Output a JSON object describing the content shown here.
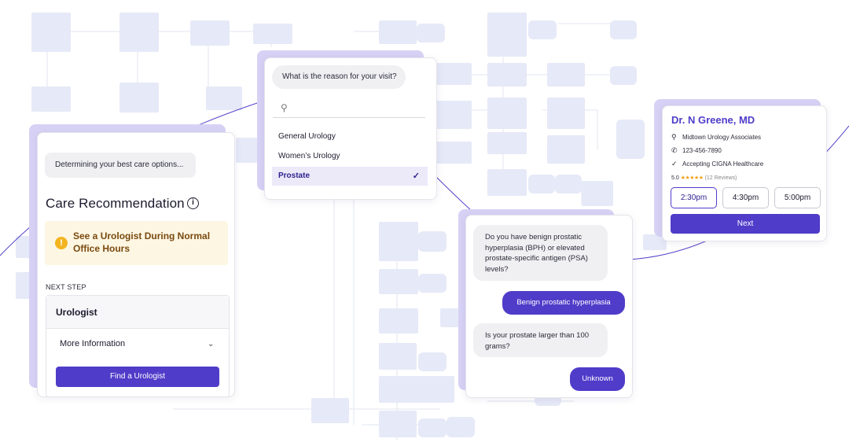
{
  "care_card": {
    "status_message": "Determining your best care options...",
    "title": "Care Recommendation",
    "info_icon": "info-icon",
    "alert_icon": "warning-icon",
    "alert_line1": "See a Urologist During Normal",
    "alert_line2": "Office Hours",
    "next_step_label": "NEXT STEP",
    "specialist": "Urologist",
    "more_info_label": "More Information",
    "find_button": "Find a Urologist"
  },
  "visit_reason": {
    "question": "What is the reason for your visit?",
    "search_placeholder": "",
    "options": [
      {
        "label": "General Urology"
      },
      {
        "label": "Women’s Urology"
      },
      {
        "label": "Prostate",
        "selected": true
      }
    ]
  },
  "doctor_card": {
    "name": "Dr. N Greene, MD",
    "practice": "Midtown Urology Associates",
    "phone": "123-456-7890",
    "insurance": "Accepting CIGNA Healthcare",
    "rating": "5.0",
    "stars": "★★★★★",
    "reviews": "(12 Reviews)",
    "time_slots": [
      "2:30pm",
      "4:30pm",
      "5:00pm"
    ],
    "selected_slot": "2:30pm",
    "next_button": "Next"
  },
  "chat": {
    "question1_lines": [
      "Do you have benign prostatic",
      "hyperplasia (BPH) or elevated",
      "prostate-specific antigen (PSA)",
      "levels?"
    ],
    "answer1": "Benign prostatic hyperplasia",
    "question2_lines": [
      "Is your prostate larger than 100",
      "grams?"
    ],
    "answer2": "Unknown"
  },
  "colors": {
    "accent": "#4f3cc9",
    "accent_light": "#d7d2f5",
    "alert_bg": "#fdf6e3",
    "alert_icon": "#f3b420",
    "flowchart_box": "#e6e9f7"
  }
}
